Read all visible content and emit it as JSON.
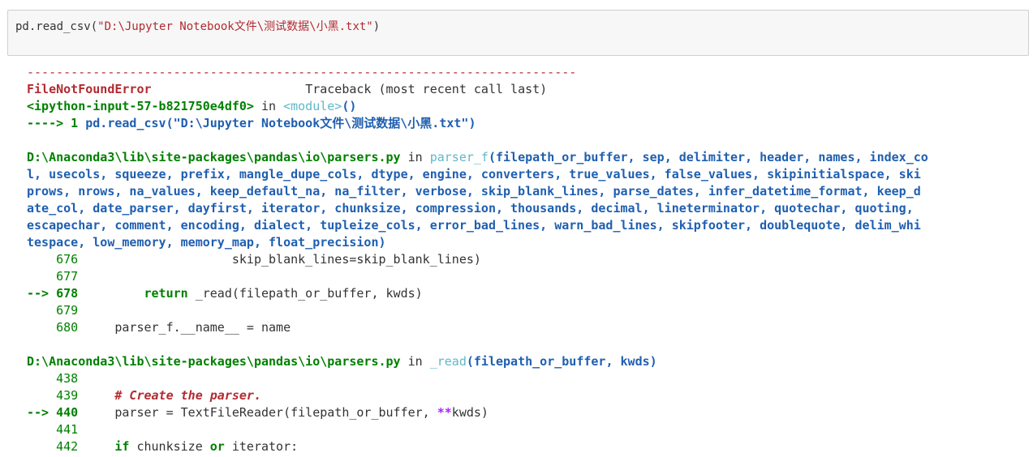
{
  "input": {
    "code_prefix": "pd.read_csv(",
    "code_string": "\"D:\\Jupyter Notebook文件\\测试数据\\小黑.txt\"",
    "code_suffix": ")"
  },
  "traceback": {
    "rule": "---------------------------------------------------------------------------",
    "error_name": "FileNotFoundError",
    "traceback_label": "Traceback (most recent call last)",
    "frame0": {
      "location": "<ipython-input-57-b821750e4df0>",
      "in": " in ",
      "func": "<module>",
      "func_paren": "()",
      "arrow": "----> 1 ",
      "code": "pd.read_csv(\"D:\\Jupyter Notebook文件\\测试数据\\小黑.txt\")"
    },
    "frame1": {
      "file": "D:\\Anaconda3\\lib\\site-packages\\pandas\\io\\parsers.py",
      "in": " in ",
      "func": "parser_f",
      "sig_lines": [
        "(filepath_or_buffer, sep, delimiter, header, names, index_co",
        "l, usecols, squeeze, prefix, mangle_dupe_cols, dtype, engine, converters, true_values, false_values, skipinitialspace, ski",
        "prows, nrows, na_values, keep_default_na, na_filter, verbose, skip_blank_lines, parse_dates, infer_datetime_format, keep_d",
        "ate_col, date_parser, dayfirst, iterator, chunksize, compression, thousands, decimal, lineterminator, quotechar, quoting,",
        "escapechar, comment, encoding, dialect, tupleize_cols, error_bad_lines, warn_bad_lines, skipfooter, doublequote, delim_whi",
        "tespace, low_memory, memory_map, float_precision)"
      ],
      "l676_num": "    676 ",
      "l676_code": "                    skip_blank_lines=skip_blank_lines)",
      "l677_num": "    677",
      "l678_arrow": "--> 678 ",
      "l678_indent": "        ",
      "l678_kw": "return",
      "l678_code": " _read(filepath_or_buffer, kwds)",
      "l679_num": "    679",
      "l680_num": "    680 ",
      "l680_code": "    parser_f.__name__ = name"
    },
    "frame2": {
      "file": "D:\\Anaconda3\\lib\\site-packages\\pandas\\io\\parsers.py",
      "in": " in ",
      "func": "_read",
      "sig": "(filepath_or_buffer, kwds)",
      "l438_num": "    438",
      "l439_num": "    439 ",
      "l439_comment": "    # Create the parser.",
      "l440_arrow": "--> 440 ",
      "l440_code": "    parser = TextFileReader(filepath_or_buffer, ",
      "l440_op": "**",
      "l440_end": "kwds)",
      "l441_num": "    441",
      "l442_num": "    442 ",
      "l442_kw1": "    if",
      "l442_mid": " chunksize ",
      "l442_kw2": "or",
      "l442_end": " iterator:"
    }
  }
}
